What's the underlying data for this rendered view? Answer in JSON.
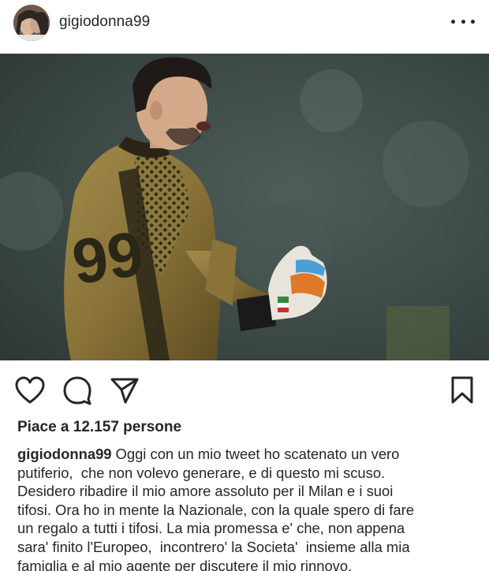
{
  "post": {
    "username": "gigiodonna99",
    "likes_text": "Piace a 12.157 persone",
    "caption_user": "gigiodonna99",
    "caption_lines": [
      "Oggi con un mio tweet ho scatenato un vero",
      "putiferio,  che non volevo generare, e di questo mi scuso.",
      "Desidero ribadire il mio amore assoluto per il Milan e i suoi",
      "tifosi. Ora ho in mente la Nazionale, con la quale spero di fare",
      "un regalo a tutti i tifosi. La mia promessa e' che, non appena",
      "sara' finito l'Europeo,  incontrero' la Societa'  insieme alla mia",
      "famiglia e al mio agente per discutere il mio rinnovo."
    ]
  },
  "icons": {
    "avatar": "profile-avatar",
    "more": "more-options-icon",
    "like": "heart-icon",
    "comment": "comment-icon",
    "share": "paper-plane-icon",
    "save": "bookmark-icon"
  },
  "colors": {
    "text": "#262626",
    "jersey": "#8a7338",
    "background_blur": "#3d4a47"
  }
}
